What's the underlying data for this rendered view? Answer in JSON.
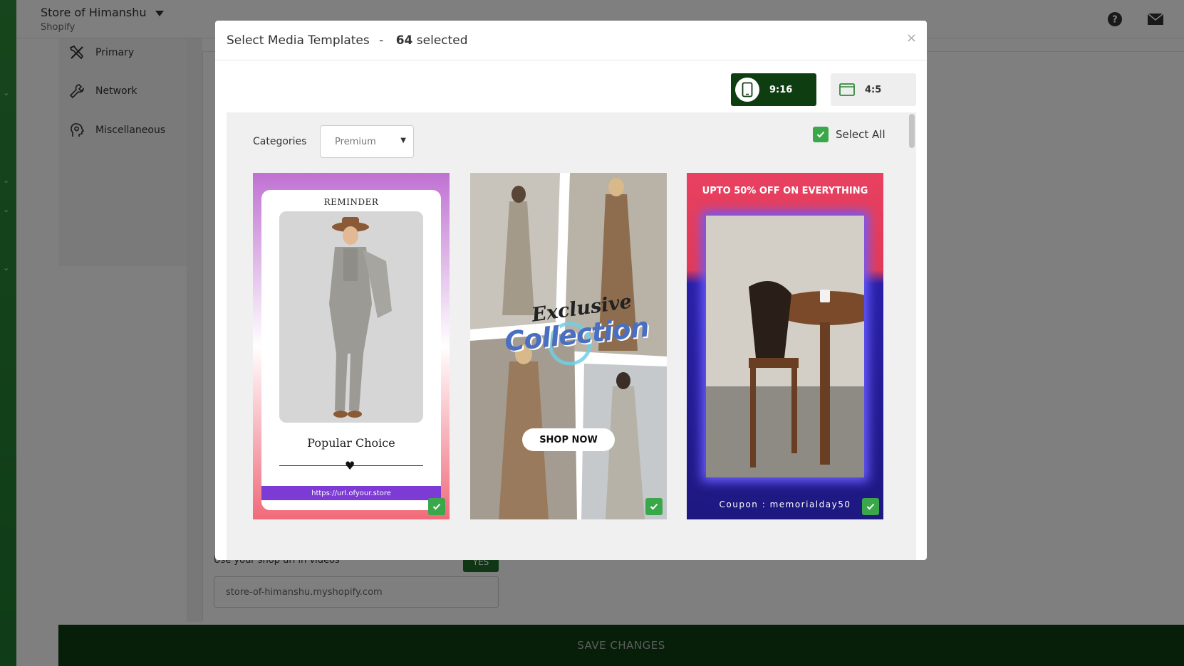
{
  "app": {
    "store_name": "Store of Himanshu",
    "platform": "Shopify"
  },
  "side_nav": {
    "items": [
      {
        "label": "Primary",
        "icon": "tools-icon"
      },
      {
        "label": "Network",
        "icon": "wrench-icon"
      },
      {
        "label": "Miscellaneous",
        "icon": "gear-head-icon"
      }
    ]
  },
  "background_form": {
    "shop_url_label": "Use your shop url in videos",
    "shop_url_toggle": "YES",
    "shop_url_value": "store-of-himanshu.myshopify.com",
    "save_label": "SAVE CHANGES"
  },
  "modal": {
    "title": "Select Media Templates",
    "separator": "-",
    "selected_count": "64",
    "selected_suffix": "selected",
    "close_glyph": "×",
    "ratios": [
      {
        "label": "9:16",
        "active": true
      },
      {
        "label": "4:5",
        "active": false
      }
    ],
    "categories_label": "Categories",
    "category_selected": "Premium",
    "select_all_label": "Select All",
    "select_all_checked": true
  },
  "templates": [
    {
      "name": "reminder-template",
      "reminder": "REMINDER",
      "tagline": "Popular Choice",
      "url": "https://url.ofyour.store",
      "selected": true
    },
    {
      "name": "exclusive-collection-template",
      "headline_script": "Exclusive",
      "headline": "Collection",
      "cta": "SHOP NOW",
      "selected": true
    },
    {
      "name": "sale-template",
      "headline": "UPTO 50% OFF ON EVERYTHING",
      "coupon": "Coupon : memorialday50",
      "selected": true
    }
  ],
  "colors": {
    "accent_dark": "#0f3d12",
    "check_green": "#3aa84a",
    "rail_green": "#2e8b3a"
  }
}
